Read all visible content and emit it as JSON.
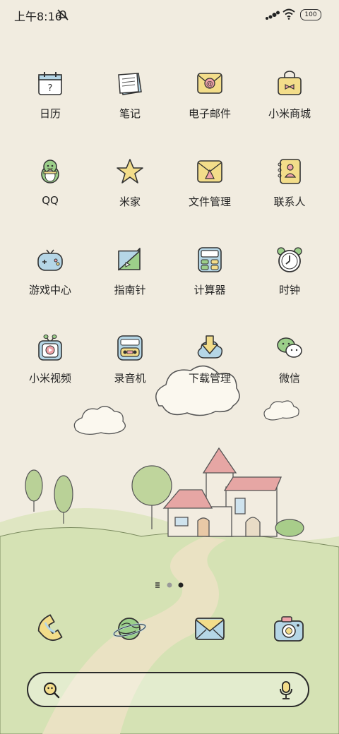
{
  "status_bar": {
    "time": "上午8:16",
    "battery": "100"
  },
  "apps": [
    {
      "label": "日历",
      "icon": "calendar-icon"
    },
    {
      "label": "笔记",
      "icon": "notes-icon"
    },
    {
      "label": "电子邮件",
      "icon": "email-icon"
    },
    {
      "label": "小米商城",
      "icon": "shopping-bag-icon"
    },
    {
      "label": "QQ",
      "icon": "qq-penguin-icon"
    },
    {
      "label": "米家",
      "icon": "star-icon"
    },
    {
      "label": "文件管理",
      "icon": "folder-icon"
    },
    {
      "label": "联系人",
      "icon": "contacts-icon"
    },
    {
      "label": "游戏中心",
      "icon": "gamepad-icon"
    },
    {
      "label": "指南针",
      "icon": "compass-icon"
    },
    {
      "label": "计算器",
      "icon": "calculator-icon"
    },
    {
      "label": "时钟",
      "icon": "alarm-clock-icon"
    },
    {
      "label": "小米视频",
      "icon": "tv-play-icon"
    },
    {
      "label": "录音机",
      "icon": "recorder-icon"
    },
    {
      "label": "下载管理",
      "icon": "download-cloud-icon"
    },
    {
      "label": "微信",
      "icon": "wechat-icon"
    }
  ],
  "dock": [
    {
      "icon": "phone-icon"
    },
    {
      "icon": "browser-planet-icon"
    },
    {
      "icon": "messages-envelope-icon"
    },
    {
      "icon": "camera-icon"
    }
  ],
  "page_indicator": {
    "pages": 3,
    "current": 2
  },
  "colors": {
    "background": "#f1ece0",
    "grass": "#cfe0b0",
    "accent_yellow": "#f3dd8a",
    "accent_pink": "#efa2a8",
    "accent_blue": "#b5d6e6",
    "accent_green": "#9ccf8a"
  }
}
